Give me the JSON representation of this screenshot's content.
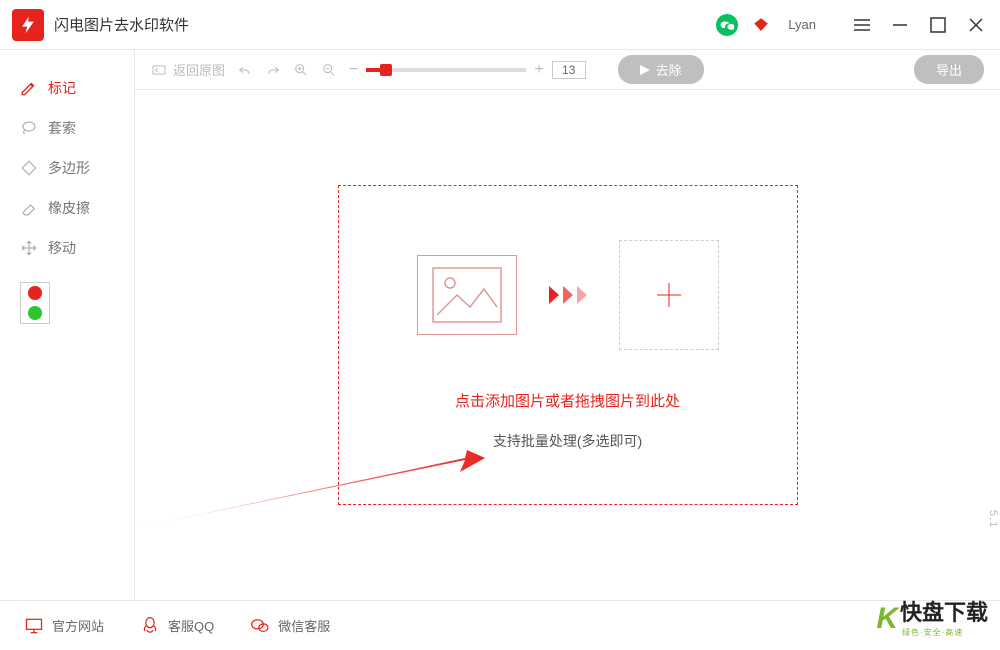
{
  "app": {
    "title": "闪电图片去水印软件",
    "user": "Lyan"
  },
  "sidebar": {
    "tools": [
      {
        "label": "标记"
      },
      {
        "label": "套索"
      },
      {
        "label": "多边形"
      },
      {
        "label": "橡皮擦"
      },
      {
        "label": "移动"
      }
    ]
  },
  "toolbar": {
    "back": "返回原图",
    "slider_value": "13",
    "remove": "去除",
    "export": "导出"
  },
  "dropzone": {
    "line1": "点击添加图片或者拖拽图片到此处",
    "line2": "支持批量处理(多选即可)"
  },
  "footer": {
    "website": "官方网站",
    "qq": "客服QQ",
    "wechat": "微信客服"
  },
  "watermark": {
    "brand": "快盘下载",
    "sub": "绿色·安全·高速"
  }
}
